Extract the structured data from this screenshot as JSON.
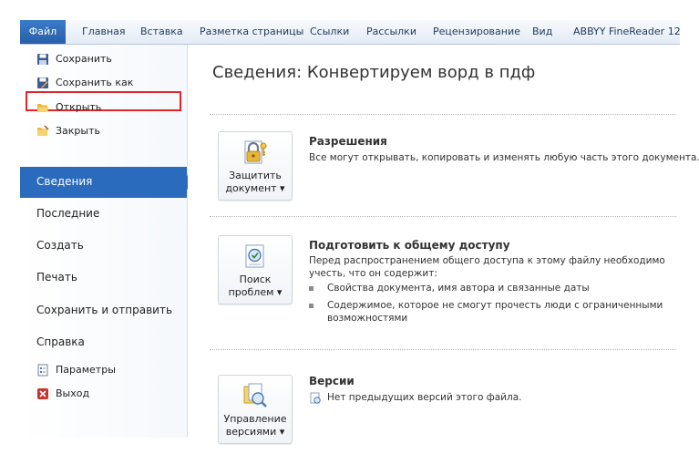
{
  "ribbon": {
    "tabs": [
      {
        "label": "Файл"
      },
      {
        "label": "Главная"
      },
      {
        "label": "Вставка"
      },
      {
        "label": "Разметка страницы"
      },
      {
        "label": "Ссылки"
      },
      {
        "label": "Рассылки"
      },
      {
        "label": "Рецензирование"
      },
      {
        "label": "Вид"
      },
      {
        "label": "ABBYY FineReader 12"
      }
    ]
  },
  "backstage": {
    "commands": [
      {
        "label": "Сохранить",
        "icon": "save-icon"
      },
      {
        "label": "Сохранить как",
        "icon": "save-as-icon"
      },
      {
        "label": "Открыть",
        "icon": "open-folder-icon"
      },
      {
        "label": "Закрыть",
        "icon": "close-folder-icon"
      }
    ],
    "nav": [
      {
        "label": "Сведения"
      },
      {
        "label": "Последние"
      },
      {
        "label": "Создать"
      },
      {
        "label": "Печать"
      },
      {
        "label": "Сохранить и отправить"
      },
      {
        "label": "Справка"
      }
    ],
    "bottom_commands": [
      {
        "label": "Параметры",
        "icon": "options-icon"
      },
      {
        "label": "Выход",
        "icon": "exit-icon"
      }
    ]
  },
  "info": {
    "title": "Сведения: Конвертируем ворд в пдф",
    "permissions": {
      "button_line1": "Защитить",
      "button_line2": "документ ▾",
      "title": "Разрешения",
      "text": "Все могут открывать, копировать и изменять любую часть этого документа."
    },
    "prepare": {
      "button_line1": "Поиск",
      "button_line2": "проблем ▾",
      "title": "Подготовить к общему доступу",
      "text_line1": "Перед распространением общего доступа к этому файлу необходимо",
      "text_line2": "учесть, что он содержит:",
      "bullet1": "Свойства документа, имя автора и связанные даты",
      "bullet2_line1": "Содержимое, которое не смогут прочесть люди с ограниченными",
      "bullet2_line2": "возможностями"
    },
    "versions": {
      "button_line1": "Управление",
      "button_line2": "версиями ▾",
      "title": "Версии",
      "text": "Нет предыдущих версий этого файла."
    }
  },
  "colors": {
    "file_tab": "#2a5ea8",
    "active_nav": "#2a6bbe",
    "highlight_border": "#e0262b"
  }
}
